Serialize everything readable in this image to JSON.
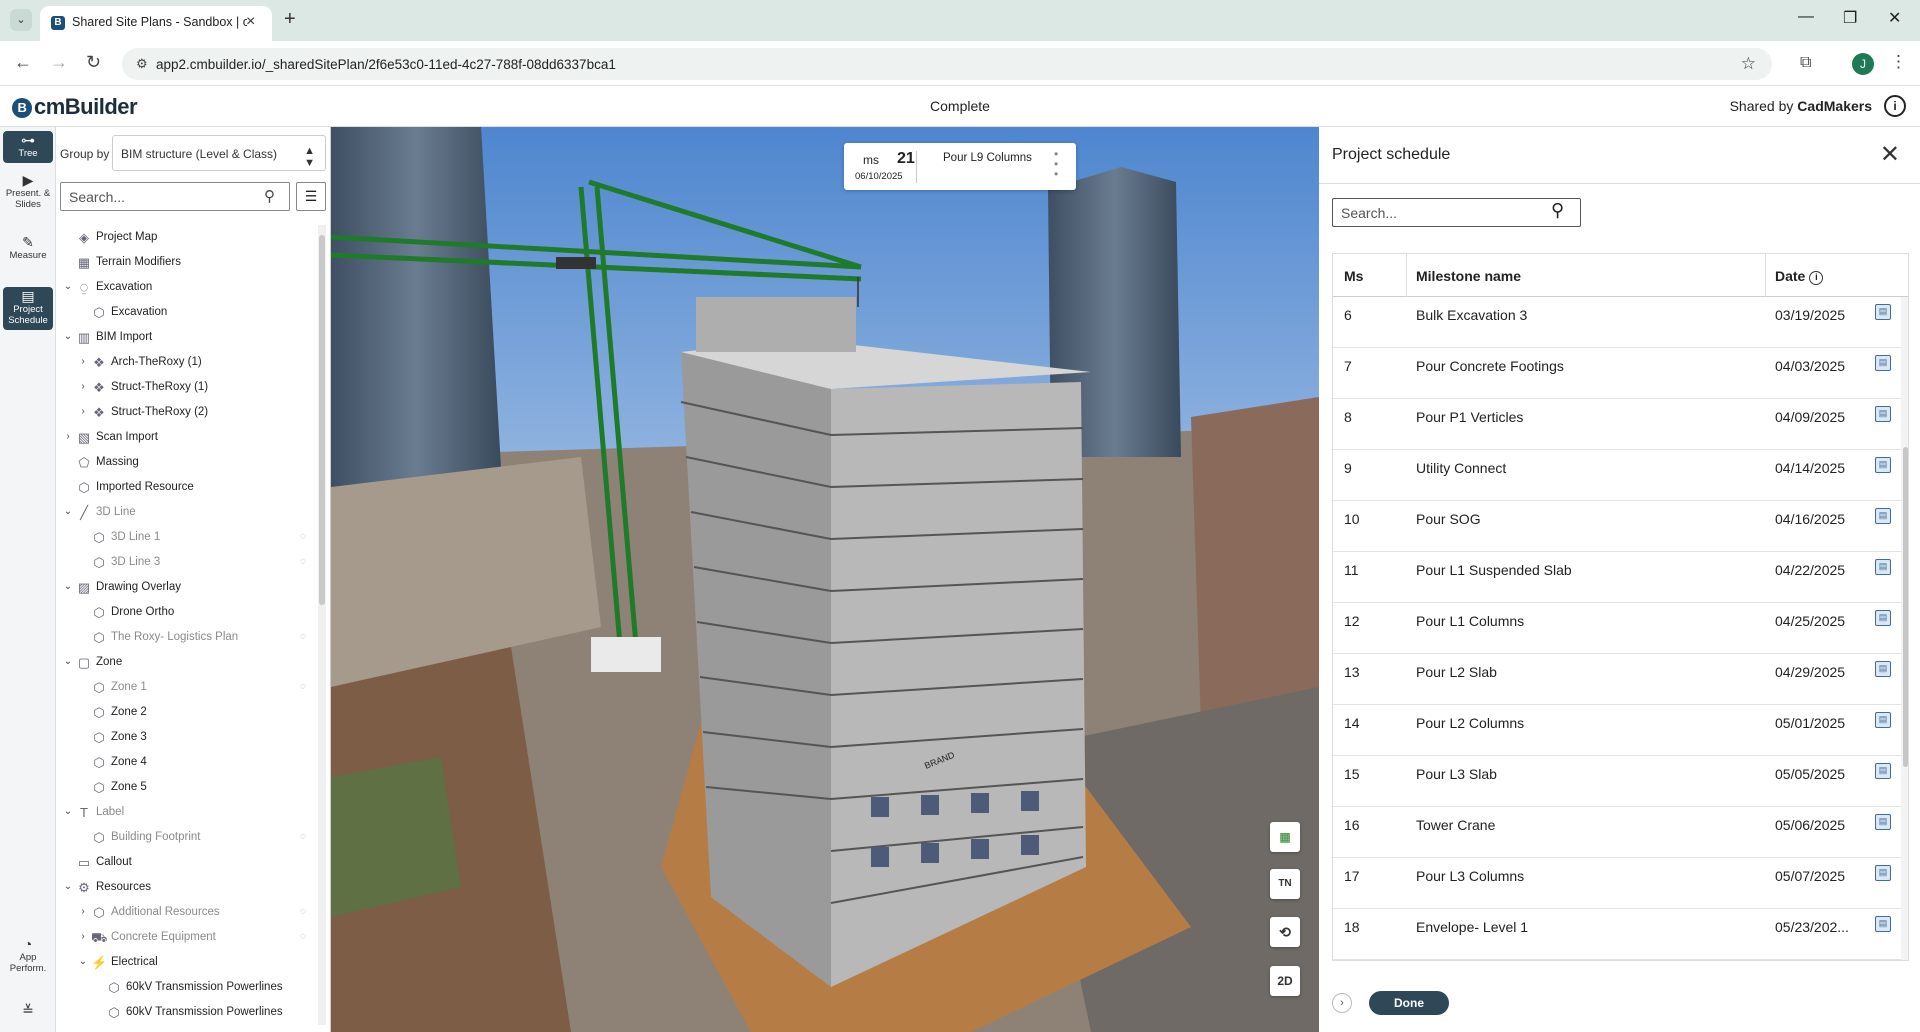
{
  "browser": {
    "tab_title": "Shared Site Plans - Sandbox | cm",
    "url": "app2.cmbuilder.io/_sharedSitePlan/2f6e53c0-11ed-4c27-788f-08dd6337bca1",
    "profile_initial": "J"
  },
  "app": {
    "logo": "cmBuilder",
    "center_title": "Complete",
    "shared_by_prefix": "Shared by",
    "shared_by_name": "CadMakers"
  },
  "rail": [
    {
      "label": "Tree",
      "icon": "tree-icon"
    },
    {
      "label": "Present. & Slides",
      "icon": "presentation-icon"
    },
    {
      "label": "Measure",
      "icon": "measure-icon"
    },
    {
      "label": "Project Schedule",
      "icon": "schedule-icon"
    },
    {
      "label": "App Perform.",
      "icon": "performance-icon"
    }
  ],
  "tree_panel": {
    "group_by_label": "Group by",
    "group_by_value": "BIM structure (Level & Class)",
    "search_placeholder": "Search...",
    "items": [
      {
        "label": "Project Map",
        "level": 0,
        "chevron": "",
        "icon": "map-icon",
        "dim": false,
        "eye": false
      },
      {
        "label": "Terrain Modifiers",
        "level": 0,
        "chevron": "",
        "icon": "terrain-icon",
        "dim": false,
        "eye": false
      },
      {
        "label": "Excavation",
        "level": 0,
        "chevron": "v",
        "icon": "excavation-icon",
        "dim": false,
        "eye": false
      },
      {
        "label": "Excavation",
        "level": 1,
        "chevron": "",
        "icon": "cube-icon",
        "dim": false,
        "eye": false
      },
      {
        "label": "BIM Import",
        "level": 0,
        "chevron": "v",
        "icon": "bim-icon",
        "dim": false,
        "eye": false
      },
      {
        "label": "Arch-TheRoxy (1)",
        "level": 1,
        "chevron": ">",
        "icon": "model-icon",
        "dim": false,
        "eye": false
      },
      {
        "label": "Struct-TheRoxy (1)",
        "level": 1,
        "chevron": ">",
        "icon": "model-icon",
        "dim": false,
        "eye": false
      },
      {
        "label": "Struct-TheRoxy (2)",
        "level": 1,
        "chevron": ">",
        "icon": "model-icon",
        "dim": false,
        "eye": false
      },
      {
        "label": "Scan Import",
        "level": 0,
        "chevron": ">",
        "icon": "scan-icon",
        "dim": false,
        "eye": false
      },
      {
        "label": "Massing",
        "level": 0,
        "chevron": "",
        "icon": "massing-icon",
        "dim": false,
        "eye": false
      },
      {
        "label": "Imported Resource",
        "level": 0,
        "chevron": "",
        "icon": "cube-icon",
        "dim": false,
        "eye": false
      },
      {
        "label": "3D Line",
        "level": 0,
        "chevron": "v",
        "icon": "line-icon",
        "dim": true,
        "eye": false
      },
      {
        "label": "3D Line 1",
        "level": 1,
        "chevron": "",
        "icon": "cube-icon",
        "dim": true,
        "eye": true
      },
      {
        "label": "3D Line 3",
        "level": 1,
        "chevron": "",
        "icon": "cube-icon",
        "dim": true,
        "eye": true
      },
      {
        "label": "Drawing Overlay",
        "level": 0,
        "chevron": "v",
        "icon": "overlay-icon",
        "dim": false,
        "eye": false
      },
      {
        "label": "Drone Ortho",
        "level": 1,
        "chevron": "",
        "icon": "cube-icon",
        "dim": false,
        "eye": false
      },
      {
        "label": "The Roxy- Logistics Plan",
        "level": 1,
        "chevron": "",
        "icon": "cube-icon",
        "dim": true,
        "eye": true
      },
      {
        "label": "Zone",
        "level": 0,
        "chevron": "v",
        "icon": "zone-icon",
        "dim": false,
        "eye": false
      },
      {
        "label": "Zone 1",
        "level": 1,
        "chevron": "",
        "icon": "cube-icon",
        "dim": true,
        "eye": true
      },
      {
        "label": "Zone 2",
        "level": 1,
        "chevron": "",
        "icon": "cube-icon",
        "dim": false,
        "eye": false
      },
      {
        "label": "Zone 3",
        "level": 1,
        "chevron": "",
        "icon": "cube-icon",
        "dim": false,
        "eye": false
      },
      {
        "label": "Zone 4",
        "level": 1,
        "chevron": "",
        "icon": "cube-icon",
        "dim": false,
        "eye": false
      },
      {
        "label": "Zone 5",
        "level": 1,
        "chevron": "",
        "icon": "cube-icon",
        "dim": false,
        "eye": false
      },
      {
        "label": "Label",
        "level": 0,
        "chevron": "v",
        "icon": "label-icon",
        "dim": true,
        "eye": false
      },
      {
        "label": "Building Footprint",
        "level": 1,
        "chevron": "",
        "icon": "cube-icon",
        "dim": true,
        "eye": true
      },
      {
        "label": "Callout",
        "level": 0,
        "chevron": "",
        "icon": "callout-icon",
        "dim": false,
        "eye": false
      },
      {
        "label": "Resources",
        "level": 0,
        "chevron": "v",
        "icon": "resources-icon",
        "dim": false,
        "eye": false
      },
      {
        "label": "Additional Resources",
        "level": 1,
        "chevron": ">",
        "icon": "resource-icon",
        "dim": true,
        "eye": true
      },
      {
        "label": "Concrete Equipment",
        "level": 1,
        "chevron": ">",
        "icon": "equipment-icon",
        "dim": true,
        "eye": true
      },
      {
        "label": "Electrical",
        "level": 1,
        "chevron": "v",
        "icon": "electrical-icon",
        "dim": false,
        "eye": false
      },
      {
        "label": "60kV Transmission Powerlines",
        "level": 2,
        "chevron": "",
        "icon": "cube-icon",
        "dim": false,
        "eye": false
      },
      {
        "label": "60kV Transmission Powerlines",
        "level": 2,
        "chevron": "",
        "icon": "cube-icon",
        "dim": false,
        "eye": false
      }
    ]
  },
  "viewer": {
    "milestone_prefix": "ms",
    "milestone_number": "21",
    "milestone_date": "06/10/2025",
    "milestone_name": "Pour L9 Columns",
    "sign_text": "BRAND",
    "tools": [
      {
        "name": "layer-tool-icon",
        "label": "▦"
      },
      {
        "name": "north-compass-icon",
        "label": "TN"
      },
      {
        "name": "rotate-view-icon",
        "label": "⟲"
      },
      {
        "name": "2d-toggle-button",
        "label": "2D"
      }
    ]
  },
  "schedule": {
    "title": "Project schedule",
    "search_placeholder": "Search...",
    "col_ms": "Ms",
    "col_name": "Milestone name",
    "col_date": "Date",
    "done_label": "Done",
    "rows": [
      {
        "ms": "6",
        "name": "Bulk Excavation 3",
        "date": "03/19/2025"
      },
      {
        "ms": "7",
        "name": "Pour Concrete Footings",
        "date": "04/03/2025"
      },
      {
        "ms": "8",
        "name": "Pour P1 Verticles",
        "date": "04/09/2025"
      },
      {
        "ms": "9",
        "name": "Utility Connect",
        "date": "04/14/2025"
      },
      {
        "ms": "10",
        "name": "Pour SOG",
        "date": "04/16/2025"
      },
      {
        "ms": "11",
        "name": "Pour L1 Suspended Slab",
        "date": "04/22/2025"
      },
      {
        "ms": "12",
        "name": "Pour L1 Columns",
        "date": "04/25/2025"
      },
      {
        "ms": "13",
        "name": "Pour L2 Slab",
        "date": "04/29/2025"
      },
      {
        "ms": "14",
        "name": "Pour L2 Columns",
        "date": "05/01/2025"
      },
      {
        "ms": "15",
        "name": "Pour L3 Slab",
        "date": "05/05/2025"
      },
      {
        "ms": "16",
        "name": "Tower Crane",
        "date": "05/06/2025"
      },
      {
        "ms": "17",
        "name": "Pour L3 Columns",
        "date": "05/07/2025"
      },
      {
        "ms": "18",
        "name": "Envelope- Level 1",
        "date": "05/23/202..."
      }
    ]
  }
}
